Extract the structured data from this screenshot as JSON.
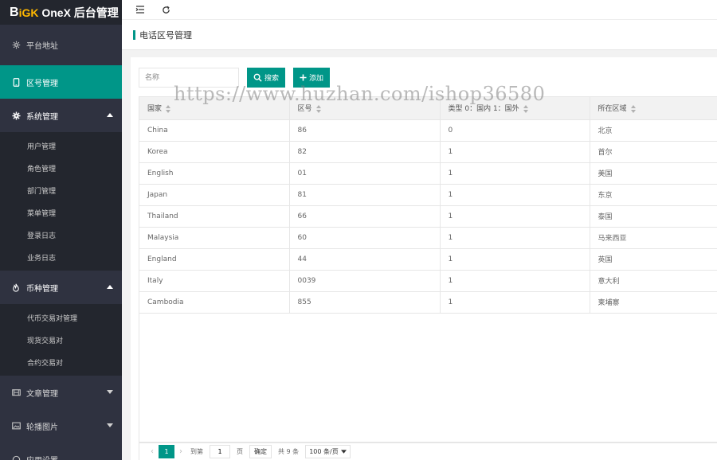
{
  "app": {
    "logo_b": "B",
    "logo_gk": "iGK",
    "logo_rest": " OneX 后台管理"
  },
  "sidebar": {
    "platform": "平台地址",
    "area_code": "区号管理",
    "system": {
      "label": "系统管理",
      "items": [
        "用户管理",
        "角色管理",
        "部门管理",
        "菜单管理",
        "登录日志",
        "业务日志"
      ]
    },
    "currency": {
      "label": "币种管理",
      "items": [
        "代币交易对管理",
        "现货交易对",
        "合约交易对"
      ]
    },
    "article": "文章管理",
    "carousel": "轮播图片",
    "next_item": "应用设置"
  },
  "breadcrumb": {
    "title": "电话区号管理"
  },
  "toolbar": {
    "search_placeholder": "名称",
    "search_label": "搜索",
    "add_label": "添加"
  },
  "table": {
    "headers": [
      "国家",
      "区号",
      "类型 0：国内 1：国外",
      "所在区域"
    ],
    "rows": [
      [
        "China",
        "86",
        "0",
        "北京"
      ],
      [
        "Korea",
        "82",
        "1",
        "首尔"
      ],
      [
        "English",
        "01",
        "1",
        "美国"
      ],
      [
        "Japan",
        "81",
        "1",
        "东京"
      ],
      [
        "Thailand",
        "66",
        "1",
        "泰国"
      ],
      [
        "Malaysia",
        "60",
        "1",
        "马来西亚"
      ],
      [
        "England",
        "44",
        "1",
        "英国"
      ],
      [
        "Italy",
        "0039",
        "1",
        "意大利"
      ],
      [
        "Cambodia",
        "855",
        "1",
        "柬埔寨"
      ]
    ]
  },
  "pager": {
    "prev": "‹",
    "current": "1",
    "next": "›",
    "goto": "到第",
    "goto_value": "1",
    "page_unit": "页",
    "confirm": "确定",
    "total": "共 9 条",
    "per_page": "100 条/页"
  },
  "watermark": "https://www.huzhan.com/ishop36580",
  "colors": {
    "accent": "#009688",
    "sidebar_bg": "#2f3240",
    "sidebar_dark": "#23262e"
  }
}
